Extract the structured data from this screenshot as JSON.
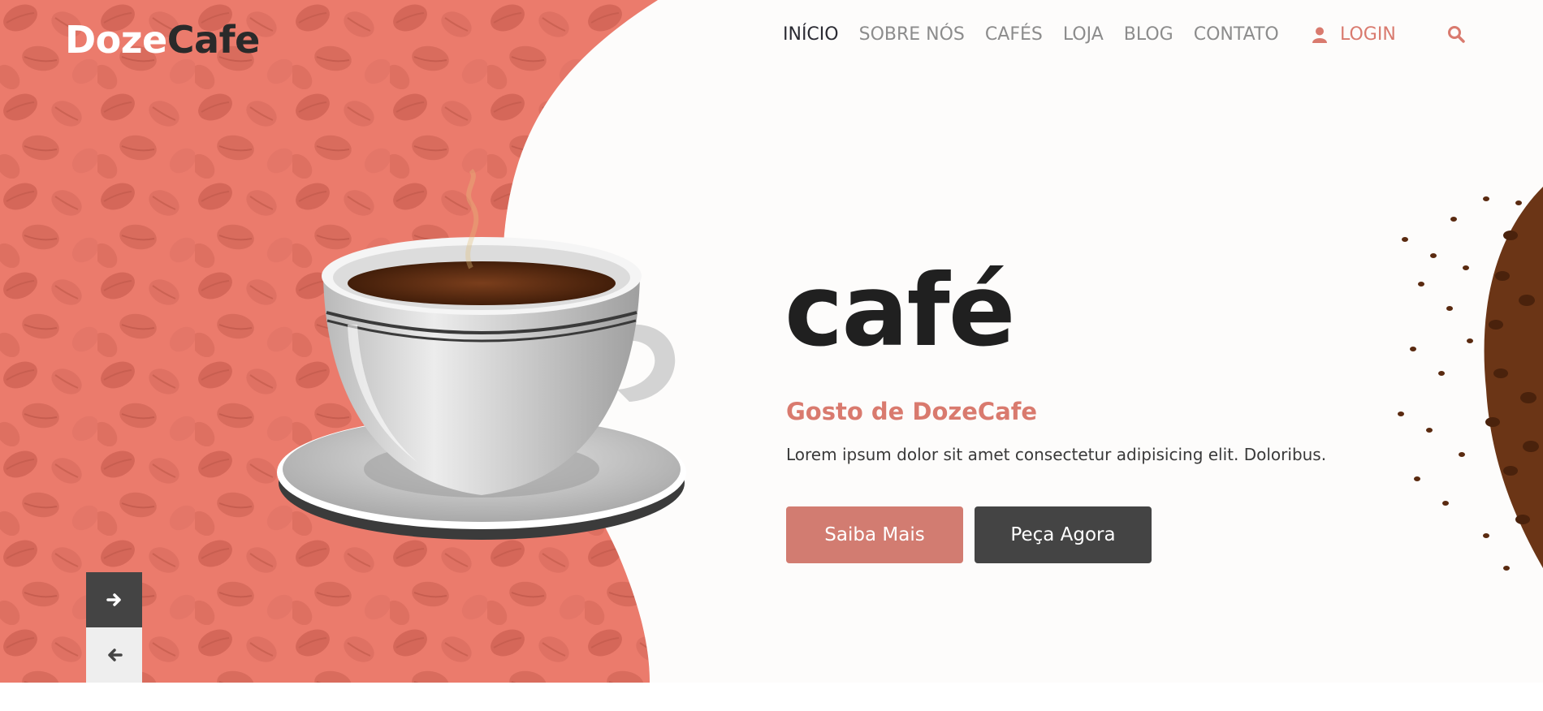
{
  "brand": {
    "part1": "Doze",
    "part2": "Cafe"
  },
  "nav": {
    "items": [
      {
        "label": "INÍCIO",
        "active": true
      },
      {
        "label": "SOBRE NÓS"
      },
      {
        "label": "CAFÉS"
      },
      {
        "label": "LOJA"
      },
      {
        "label": "BLOG"
      },
      {
        "label": "CONTATO"
      }
    ],
    "login_label": "LOGIN"
  },
  "hero": {
    "title": "café",
    "subtitle": "Gosto de DozeCafe",
    "description": "Lorem ipsum dolor sit amet consectetur adipisicing elit. Doloribus.",
    "primary_button": "Saiba Mais",
    "secondary_button": "Peça Agora"
  },
  "icons": {
    "login": "user-icon",
    "search": "search-icon",
    "next": "arrow-right-icon",
    "prev": "arrow-left-icon"
  },
  "colors": {
    "accent": "#d97a6e",
    "dark_button": "#444444",
    "title": "#202020"
  }
}
